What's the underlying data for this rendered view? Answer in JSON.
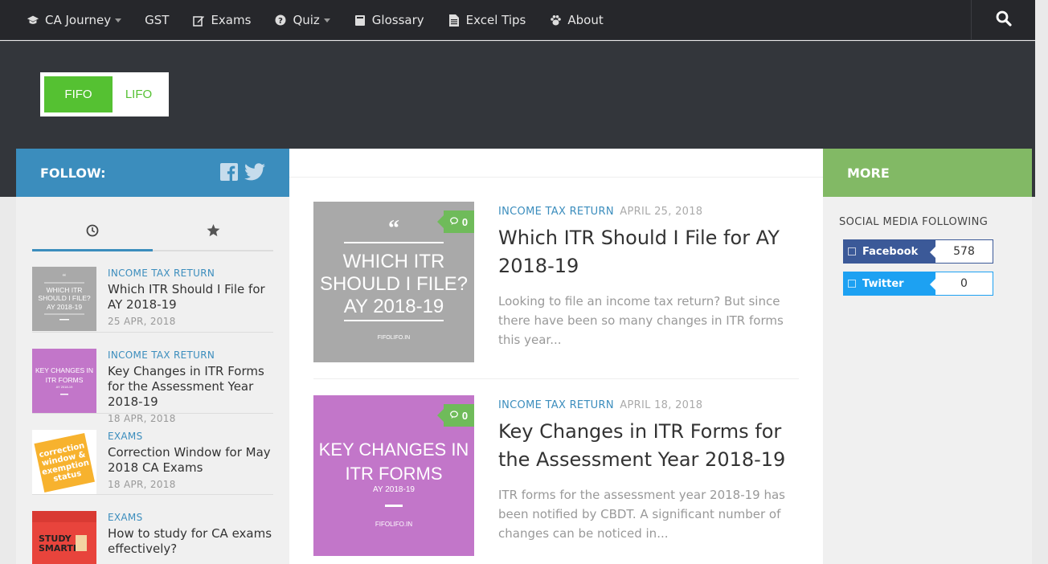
{
  "nav": {
    "items": [
      {
        "label": "CA Journey",
        "icon": "graduation-cap-icon",
        "dropdown": true
      },
      {
        "label": "GST",
        "icon": "",
        "dropdown": false
      },
      {
        "label": "Exams",
        "icon": "edit-icon",
        "dropdown": false
      },
      {
        "label": "Quiz",
        "icon": "question-circle-icon",
        "dropdown": true
      },
      {
        "label": "Glossary",
        "icon": "book-icon",
        "dropdown": false
      },
      {
        "label": "Excel Tips",
        "icon": "file-text-icon",
        "dropdown": false
      },
      {
        "label": "About",
        "icon": "paw-icon",
        "dropdown": false
      }
    ]
  },
  "logo": {
    "left": "FIFO",
    "right": "LIFO"
  },
  "sidebar_left": {
    "follow_label": "FOLLOW:",
    "posts": [
      {
        "category": "INCOME TAX RETURN",
        "title": "Which ITR Should I File for AY 2018-19",
        "date": "25 APR, 2018",
        "thumb_lines": [
          "WHICH ITR",
          "SHOULD I FILE?",
          "AY 2018-19"
        ]
      },
      {
        "category": "INCOME TAX RETURN",
        "title": "Key Changes in ITR Forms for the Assessment Year 2018-19",
        "date": "18 APR, 2018",
        "thumb_lines": [
          "KEY CHANGES IN",
          "ITR FORMS",
          "AY 2018-19"
        ]
      },
      {
        "category": "EXAMS",
        "title": "Correction Window for May 2018 CA Exams",
        "date": "18 APR, 2018",
        "thumb_lines": [
          "correction",
          "window &",
          "exemption",
          "status"
        ]
      },
      {
        "category": "EXAMS",
        "title": "How to study for CA exams effectively?",
        "date": "",
        "thumb_lines": [
          "STUDY",
          "SMARTLY"
        ]
      }
    ]
  },
  "main": {
    "posts": [
      {
        "category": "INCOME TAX RETURN",
        "date": "APRIL 25, 2018",
        "title": "Which ITR Should I File for AY 2018-19",
        "excerpt": "Looking to file an income tax return? But since there have been so many changes in ITR forms this year...",
        "comments": "0",
        "img_lines": [
          "WHICH ITR",
          "SHOULD I FILE?",
          "AY 2018-19"
        ],
        "img_site": "FIFOLIFO.IN"
      },
      {
        "category": "INCOME TAX RETURN",
        "date": "APRIL 18, 2018",
        "title": "Key Changes in ITR Forms for the Assessment Year 2018-19",
        "excerpt": "ITR forms for the assessment year 2018-19 has been notified by CBDT. A significant number of changes can be noticed in...",
        "comments": "0",
        "img_lines": [
          "KEY CHANGES IN",
          "ITR FORMS",
          "AY 2018-19"
        ],
        "img_site": "FIFOLIFO.IN"
      }
    ]
  },
  "sidebar_right": {
    "more_label": "MORE",
    "social_heading": "SOCIAL MEDIA FOLLOWING",
    "facebook": {
      "label": "Facebook",
      "count": "578"
    },
    "twitter": {
      "label": "Twitter",
      "count": "0"
    }
  },
  "colors": {
    "nav_bg": "#26272b",
    "header_bg": "#33363b",
    "blue": "#3b8dbd",
    "green": "#82b965",
    "logo_green": "#55c132"
  }
}
